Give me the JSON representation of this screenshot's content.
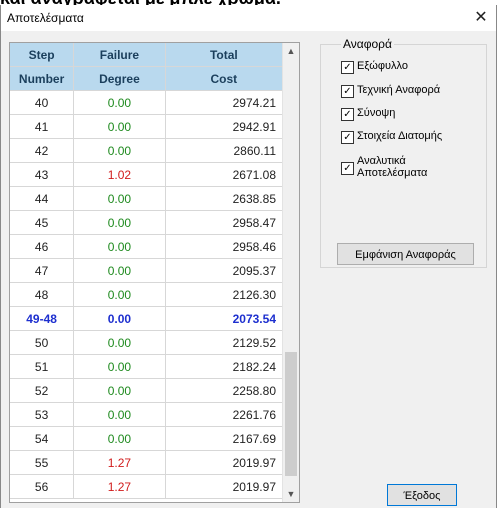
{
  "window": {
    "title": "Αποτελέσματα",
    "close_glyph": "✕"
  },
  "table": {
    "headers": [
      {
        "line1": "Step",
        "line2": "Number"
      },
      {
        "line1": "Failure",
        "line2": "Degree"
      },
      {
        "line1": "Total",
        "line2": "Cost"
      }
    ],
    "rows": [
      {
        "step": "40",
        "failure": "0.00",
        "cost": "2974.21",
        "failure_color": "green"
      },
      {
        "step": "41",
        "failure": "0.00",
        "cost": "2942.91",
        "failure_color": "green"
      },
      {
        "step": "42",
        "failure": "0.00",
        "cost": "2860.11",
        "failure_color": "green"
      },
      {
        "step": "43",
        "failure": "1.02",
        "cost": "2671.08",
        "failure_color": "red"
      },
      {
        "step": "44",
        "failure": "0.00",
        "cost": "2638.85",
        "failure_color": "green"
      },
      {
        "step": "45",
        "failure": "0.00",
        "cost": "2958.47",
        "failure_color": "green"
      },
      {
        "step": "46",
        "failure": "0.00",
        "cost": "2958.46",
        "failure_color": "green"
      },
      {
        "step": "47",
        "failure": "0.00",
        "cost": "2095.37",
        "failure_color": "green"
      },
      {
        "step": "48",
        "failure": "0.00",
        "cost": "2126.30",
        "failure_color": "green"
      },
      {
        "step": "49-48",
        "failure": "0.00",
        "cost": "2073.54",
        "failure_color": "blue",
        "highlight": true
      },
      {
        "step": "50",
        "failure": "0.00",
        "cost": "2129.52",
        "failure_color": "green"
      },
      {
        "step": "51",
        "failure": "0.00",
        "cost": "2182.24",
        "failure_color": "green"
      },
      {
        "step": "52",
        "failure": "0.00",
        "cost": "2258.80",
        "failure_color": "green"
      },
      {
        "step": "53",
        "failure": "0.00",
        "cost": "2261.76",
        "failure_color": "green"
      },
      {
        "step": "54",
        "failure": "0.00",
        "cost": "2167.69",
        "failure_color": "green"
      },
      {
        "step": "55",
        "failure": "1.27",
        "cost": "2019.97",
        "failure_color": "red"
      },
      {
        "step": "56",
        "failure": "1.27",
        "cost": "2019.97",
        "failure_color": "red"
      }
    ]
  },
  "report": {
    "legend": "Αναφορά",
    "options": [
      {
        "label": "Εξώφυλλο",
        "checked": true
      },
      {
        "label": "Τεχνική Αναφορά",
        "checked": true
      },
      {
        "label": "Σύνοψη",
        "checked": true
      },
      {
        "label": "Στοιχεία Διατομής",
        "checked": true
      },
      {
        "label": "Αναλυτικά Αποτελέσματα",
        "checked": true
      }
    ],
    "show_button": "Εμφάνιση Αναφοράς"
  },
  "footer": {
    "exit_button": "Έξοδος"
  },
  "colors": {
    "header_bg": "#b9d9ee",
    "green": "#1e8a1e",
    "red": "#d11b1b",
    "highlight": "#1d2fcf"
  }
}
